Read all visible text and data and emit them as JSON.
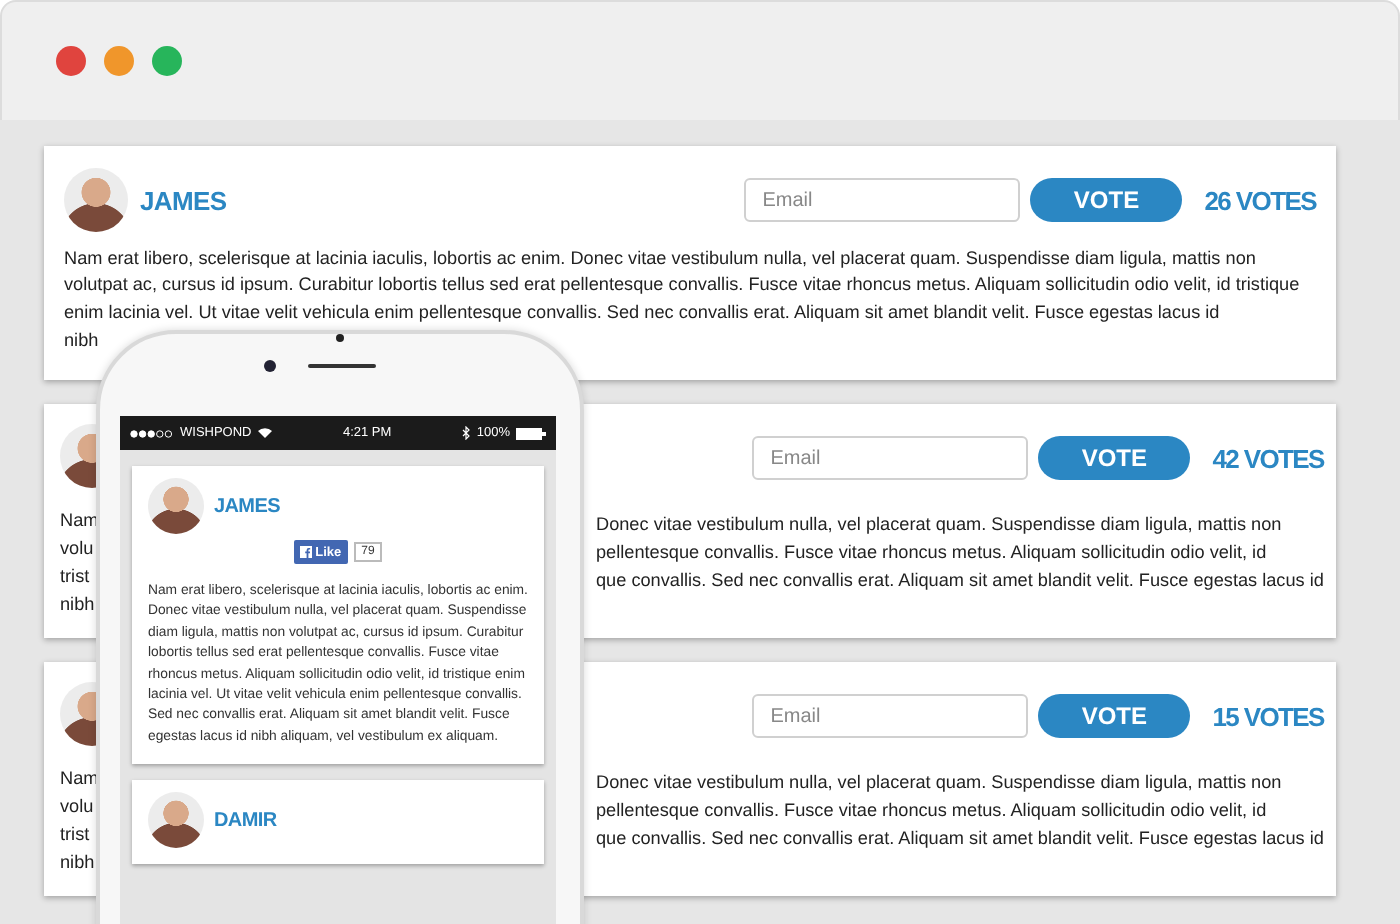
{
  "entries": [
    {
      "kind": "full",
      "name": "JAMES",
      "email_placeholder": "Email",
      "vote_label": "VOTE",
      "votes": "26 VOTES",
      "description": "Nam erat libero, scelerisque at lacinia iaculis, lobortis ac enim. Donec vitae vestibulum nulla, vel placerat quam. Suspendisse diam ligula, mattis non volutpat ac, cursus id ipsum. Curabitur lobortis tellus sed erat pellentesque convallis. Fusce vitae rhoncus metus. Aliquam sollicitudin odio velit, id tristique enim lacinia vel. Ut vitae velit vehicula enim pellentesque convallis. Sed nec convallis erat. Aliquam sit amet blandit velit. Fusce egestas lacus id",
      "trailing_fragment": "nibh"
    },
    {
      "kind": "partial",
      "email_placeholder": "Email",
      "vote_label": "VOTE",
      "votes": "42 VOTES",
      "left_fragments": [
        "Nam",
        "volu",
        "trist",
        "nibh"
      ],
      "right_fragments": [
        "Donec vitae vestibulum nulla, vel placerat quam. Suspendisse diam ligula, mattis non",
        "pellentesque convallis. Fusce vitae rhoncus metus. Aliquam sollicitudin odio velit, id",
        "que convallis. Sed nec convallis erat. Aliquam sit amet blandit velit. Fusce egestas lacus id"
      ]
    },
    {
      "kind": "partial",
      "email_placeholder": "Email",
      "vote_label": "VOTE",
      "votes": "15 VOTES",
      "left_fragments": [
        "Nam",
        "volu",
        "trist",
        "nibh"
      ],
      "right_fragments": [
        "Donec vitae vestibulum nulla, vel placerat quam. Suspendisse diam ligula, mattis non",
        "pellentesque convallis. Fusce vitae rhoncus metus. Aliquam sollicitudin odio velit, id",
        "que convallis. Sed nec convallis erat. Aliquam sit amet blandit velit. Fusce egestas lacus id"
      ]
    }
  ],
  "phone": {
    "carrier": "WISHPOND",
    "time": "4:21 PM",
    "battery": "100%",
    "entries": [
      {
        "name": "JAMES",
        "like_label": "Like",
        "like_count": "79",
        "description": "Nam erat libero, scelerisque at lacinia iaculis, lobortis ac enim. Donec vitae vestibulum nulla, vel placerat quam. Suspendisse diam ligula, mattis non volutpat ac, cursus id ipsum. Curabitur lobortis tellus sed erat pellentesque convallis. Fusce vitae rhoncus metus. Aliquam sollicitudin odio velit, id tristique enim lacinia vel. Ut vitae velit vehicula enim pellentesque convallis. Sed nec convallis erat. Aliquam sit amet blandit velit. Fusce egestas lacus id nibh aliquam, vel vestibulum ex aliquam."
      },
      {
        "name": "DAMIR"
      }
    ]
  }
}
